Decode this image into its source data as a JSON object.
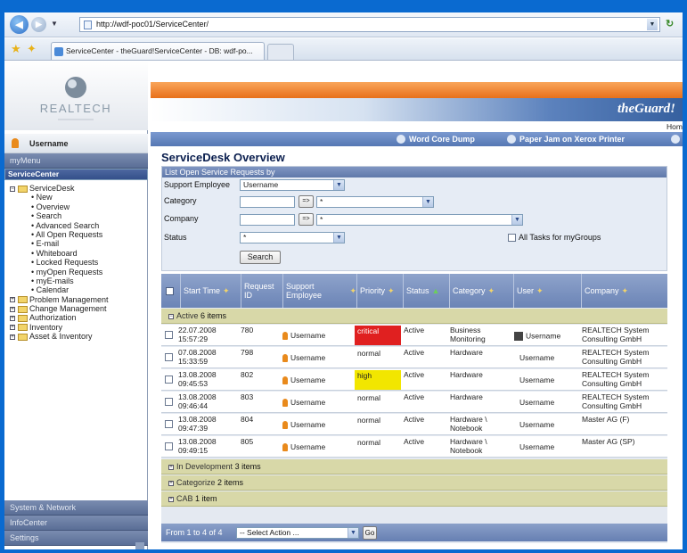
{
  "browser": {
    "url": "http://wdf-poc01/ServiceCenter/",
    "tab_title": "ServiceCenter - theGuard!ServiceCenter - DB: wdf-po..."
  },
  "sidebar": {
    "logo_text": "REALTECH",
    "username": "Username",
    "sections": {
      "my_menu": "myMenu",
      "service_center": "ServiceCenter",
      "system_network": "System & Network",
      "info_center": "InfoCenter",
      "settings": "Settings"
    },
    "tree": {
      "service_desk": "ServiceDesk",
      "items": [
        "New",
        "Overview",
        "Search",
        "Advanced Search",
        "All Open Requests",
        "E-mail",
        "Whiteboard",
        "Locked Requests",
        "myOpen Requests",
        "myE-mails",
        "Calendar"
      ],
      "folders": [
        "Problem Management",
        "Change Management",
        "Authorization",
        "Inventory",
        "Asset & Inventory"
      ]
    }
  },
  "header": {
    "brand": "theGuard!",
    "home": "Hom",
    "alert1": "Word Core Dump",
    "alert2": "Paper Jam on Xerox Printer"
  },
  "page_title": "ServiceDesk Overview",
  "filter": {
    "header": "List Open Service Requests by",
    "support_employee_label": "Support Employee",
    "support_employee_value": "Username",
    "category_label": "Category",
    "category_value": "*",
    "company_label": "Company",
    "company_value": "*",
    "status_label": "Status",
    "status_value": "*",
    "all_tasks_label": "All Tasks for myGroups",
    "search_button": "Search",
    "arrow_btn": "=>"
  },
  "table": {
    "columns": [
      "Start Time",
      "Request ID",
      "Support Employee",
      "Priority",
      "Status",
      "Category",
      "User",
      "Company"
    ],
    "group_active": "Active",
    "group_active_count": "6 items",
    "rows": [
      {
        "start": "22.07.2008",
        "time": "15:57:29",
        "id": "780",
        "employee": "Username",
        "priority": "critical",
        "status": "Active",
        "category": "Business Monitoring",
        "user": "Username",
        "company": "REALTECH System Consulting GmbH"
      },
      {
        "start": "07.08.2008",
        "time": "15:33:59",
        "id": "798",
        "employee": "Username",
        "priority": "normal",
        "status": "Active",
        "category": "Hardware",
        "user": "Username",
        "company": "REALTECH System Consulting GmbH"
      },
      {
        "start": "13.08.2008",
        "time": "09:45:53",
        "id": "802",
        "employee": "Username",
        "priority": "high",
        "status": "Active",
        "category": "Hardware",
        "user": "Username",
        "company": "REALTECH System Consulting GmbH"
      },
      {
        "start": "13.08.2008",
        "time": "09:46:44",
        "id": "803",
        "employee": "Username",
        "priority": "normal",
        "status": "Active",
        "category": "Hardware",
        "user": "Username",
        "company": "REALTECH System Consulting GmbH"
      },
      {
        "start": "13.08.2008",
        "time": "09:47:39",
        "id": "804",
        "employee": "Username",
        "priority": "normal",
        "status": "Active",
        "category": "Hardware \\ Notebook",
        "user": "Username",
        "company": "Master AG (F)"
      },
      {
        "start": "13.08.2008",
        "time": "09:49:15",
        "id": "805",
        "employee": "Username",
        "priority": "normal",
        "status": "Active",
        "category": "Hardware \\ Notebook",
        "user": "Username",
        "company": "Master AG (SP)"
      }
    ],
    "groups_collapsed": [
      {
        "name": "In Development",
        "count": "3 items"
      },
      {
        "name": "Categorize",
        "count": "2 items"
      },
      {
        "name": "CAB",
        "count": "1 item"
      }
    ],
    "footer_range": "From 1 to 4 of 4",
    "action_select": "-- Select Action ...",
    "go": "Go"
  },
  "colors": {
    "critical": "#e02020",
    "high": "#f2e600",
    "accent": "#2a62c6"
  }
}
